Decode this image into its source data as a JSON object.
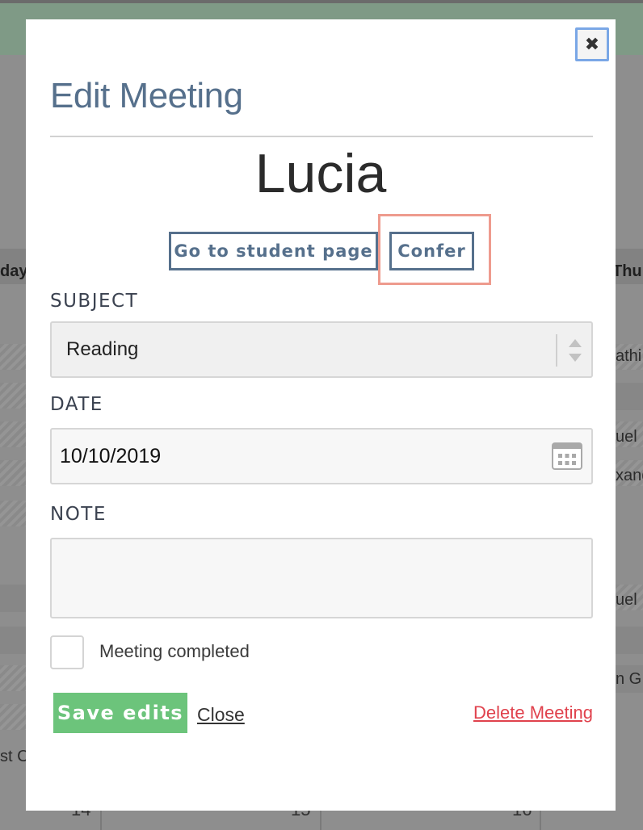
{
  "background": {
    "day_left": "day",
    "day_right": "Thu",
    "cells": [
      "athi",
      "uel",
      "xand",
      "uel",
      "n G",
      "st C"
    ],
    "dates": [
      "14",
      "15",
      "16"
    ]
  },
  "modal": {
    "close_icon": "close-icon",
    "title": "Edit Meeting",
    "student_name": "Lucia",
    "buttons": {
      "student_page": "Go to student page",
      "confer": "Confer"
    },
    "subject": {
      "label": "SUBJECT",
      "value": "Reading",
      "icon": "select-arrows-icon"
    },
    "date": {
      "label": "DATE",
      "value": "10/10/2019",
      "icon": "calendar-icon"
    },
    "note": {
      "label": "NOTE",
      "value": ""
    },
    "completed": {
      "label": "Meeting completed",
      "checked": false
    },
    "actions": {
      "save": "Save edits",
      "close": "Close",
      "delete": "Delete Meeting"
    }
  },
  "colors": {
    "title": "#56708c",
    "highlight": "#ee9b8e",
    "save": "#6cc47b",
    "delete": "#e0424d"
  }
}
